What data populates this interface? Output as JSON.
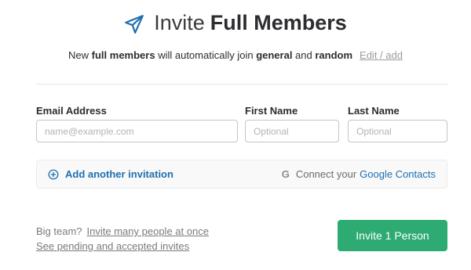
{
  "header": {
    "title_light": "Invite",
    "title_bold": "Full Members",
    "icon": "paper-plane-icon"
  },
  "subtitle": {
    "part1": "New ",
    "bold1": "full members",
    "part2": " will automatically join ",
    "bold2": "general",
    "part3": " and ",
    "bold3": "random",
    "edit_link": "Edit / add"
  },
  "form": {
    "email_label": "Email Address",
    "email_placeholder": "name@example.com",
    "first_label": "First Name",
    "first_placeholder": "Optional",
    "last_label": "Last Name",
    "last_placeholder": "Optional"
  },
  "invite_bar": {
    "add_label": "Add another invitation",
    "connect_text": "Connect your",
    "google_link": "Google Contacts",
    "google_glyph": "G"
  },
  "footer": {
    "big_team": "Big team?",
    "invite_many": "Invite many people at once",
    "pending": "See pending and accepted invites"
  },
  "actions": {
    "invite_button": "Invite 1 Person"
  },
  "colors": {
    "accent": "#1d6fb0",
    "button_green": "#2dab73"
  }
}
